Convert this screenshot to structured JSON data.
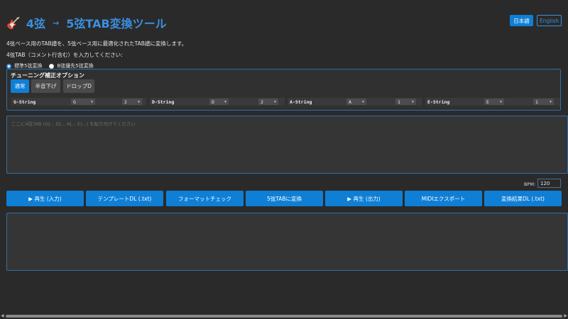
{
  "header": {
    "title_from": "4弦",
    "arrow": "→",
    "title_to": "5弦TAB変換ツール",
    "lang_ja": "日本語",
    "lang_en": "English"
  },
  "intro": {
    "description": "4弦ベース用のTAB譜を、5弦ベース用に最適化されたTAB譜に変換します。",
    "prompt": "4弦TAB（コメント行含む）を入力してください:"
  },
  "modes": [
    {
      "label": "標準5弦変換",
      "selected": true
    },
    {
      "label": "B弦優先5弦変換",
      "selected": false
    }
  ],
  "tuning": {
    "title": "チューニング補正オプション",
    "buttons": [
      {
        "label": "通常",
        "active": true
      },
      {
        "label": "半音下げ",
        "active": false
      },
      {
        "label": "ドロップD",
        "active": false
      }
    ],
    "strings": [
      {
        "name": "G-String",
        "note": "G",
        "value": "2"
      },
      {
        "name": "D-String",
        "note": "D",
        "value": "2"
      },
      {
        "name": "A-String",
        "note": "A",
        "value": "1"
      },
      {
        "name": "E-String",
        "note": "E",
        "value": "1"
      }
    ]
  },
  "input": {
    "placeholder": "ここに4弦TAB (G|... D|... A|... E|...) を貼り付けてください"
  },
  "bpm": {
    "label": "BPM:",
    "value": "120"
  },
  "actions": [
    "▶ 再生 (入力)",
    "テンプレートDL (.txt)",
    "フォーマットチェック",
    "5弦TABに変換",
    "▶ 再生 (出力)",
    "MIDIエクスポート",
    "変換結果DL (.txt)"
  ],
  "colors": {
    "accent": "#0f7fd6",
    "title": "#3b8fe0",
    "background": "#2a2a2a"
  }
}
